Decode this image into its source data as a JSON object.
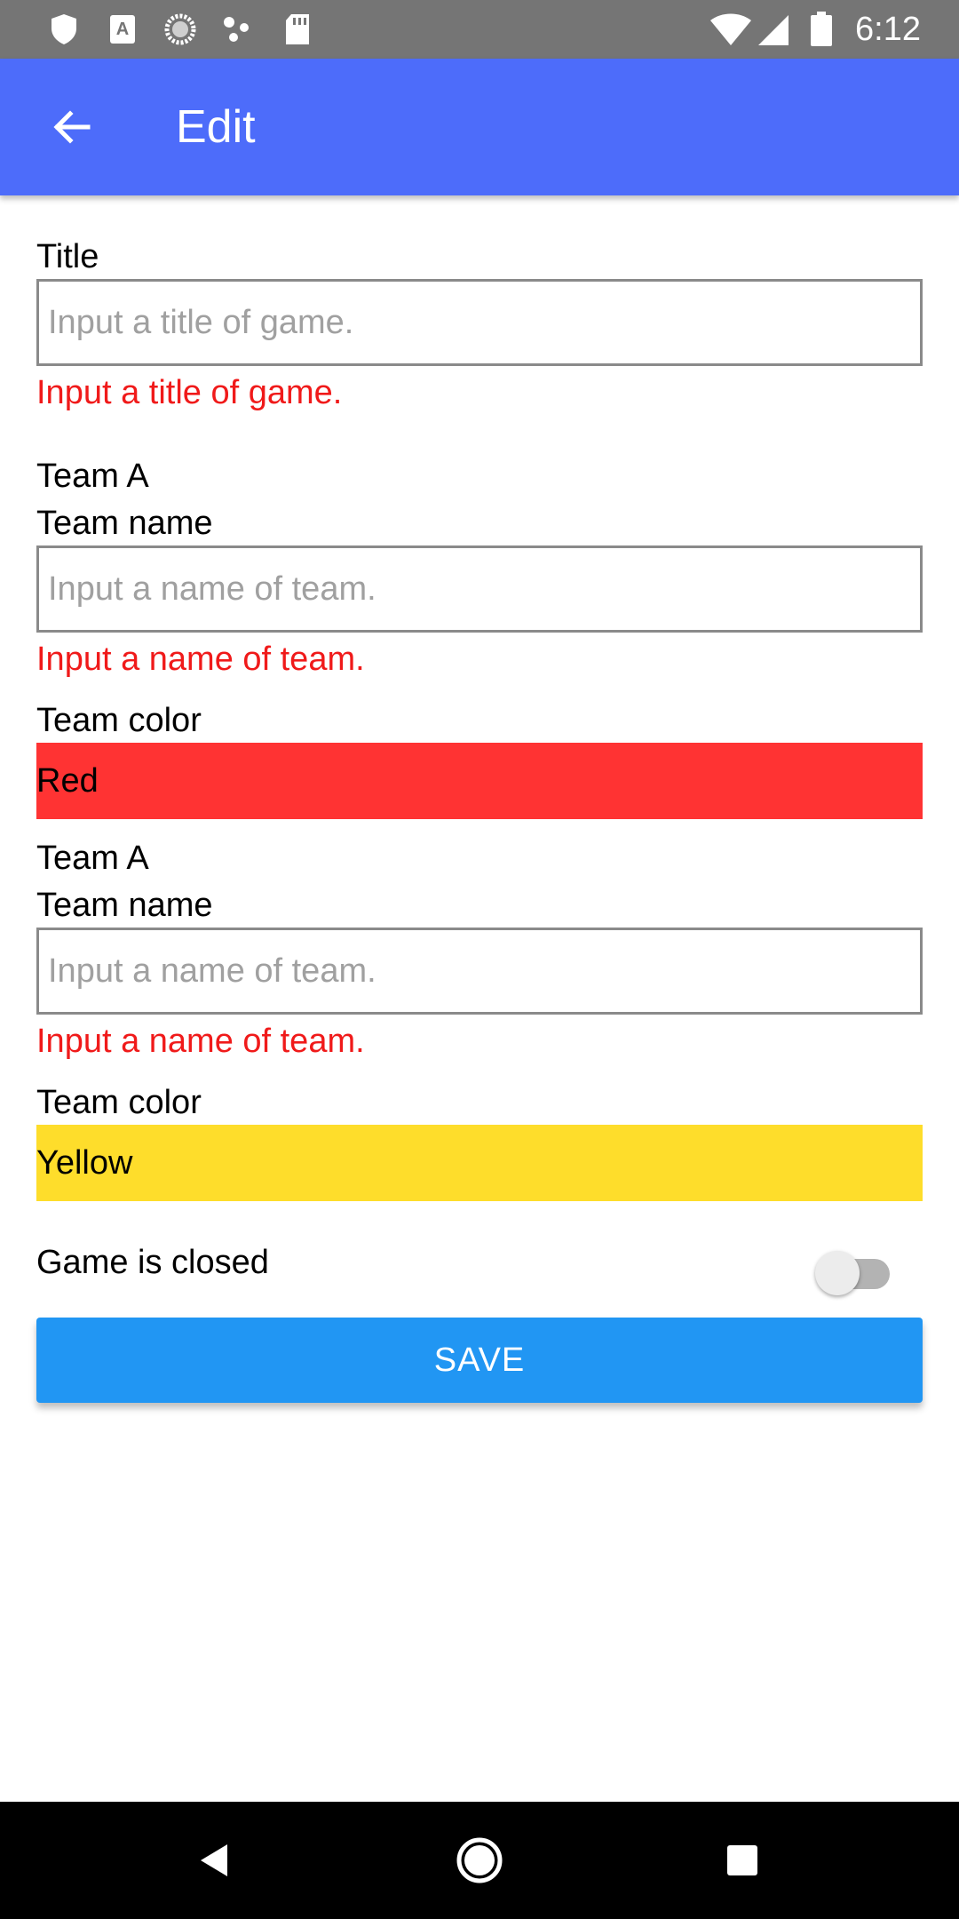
{
  "status_bar": {
    "time": "6:12",
    "icons": [
      "shield-icon",
      "font-a-icon",
      "sync-icon",
      "dots-icon",
      "sd-card-icon",
      "wifi-icon",
      "signal-icon",
      "battery-icon"
    ]
  },
  "app_bar": {
    "title": "Edit",
    "background": "#4d6cfa",
    "back_icon": "arrow-back-icon"
  },
  "form": {
    "title_label": "Title",
    "title_placeholder": "Input a title of game.",
    "title_value": "",
    "title_error": "Input a title of game.",
    "team1": {
      "header": "Team A",
      "name_label": "Team name",
      "name_placeholder": "Input a name of team.",
      "name_value": "",
      "name_error": "Input a name of team.",
      "color_label": "Team color",
      "color_value": "Red",
      "color_hex": "#ff3333"
    },
    "team2": {
      "header": "Team A",
      "name_label": "Team name",
      "name_placeholder": "Input a name of team.",
      "name_value": "",
      "name_error": "Input a name of team.",
      "color_label": "Team color",
      "color_value": "Yellow",
      "color_hex": "#fedd2b"
    },
    "closed_label": "Game is closed",
    "closed_on": false,
    "save_label": "SAVE"
  },
  "colors": {
    "error": "#f01a1a",
    "save_button": "#2196f3"
  },
  "nav_bar": {
    "icons": [
      "back-triangle-icon",
      "home-circle-icon",
      "recents-square-icon"
    ]
  }
}
